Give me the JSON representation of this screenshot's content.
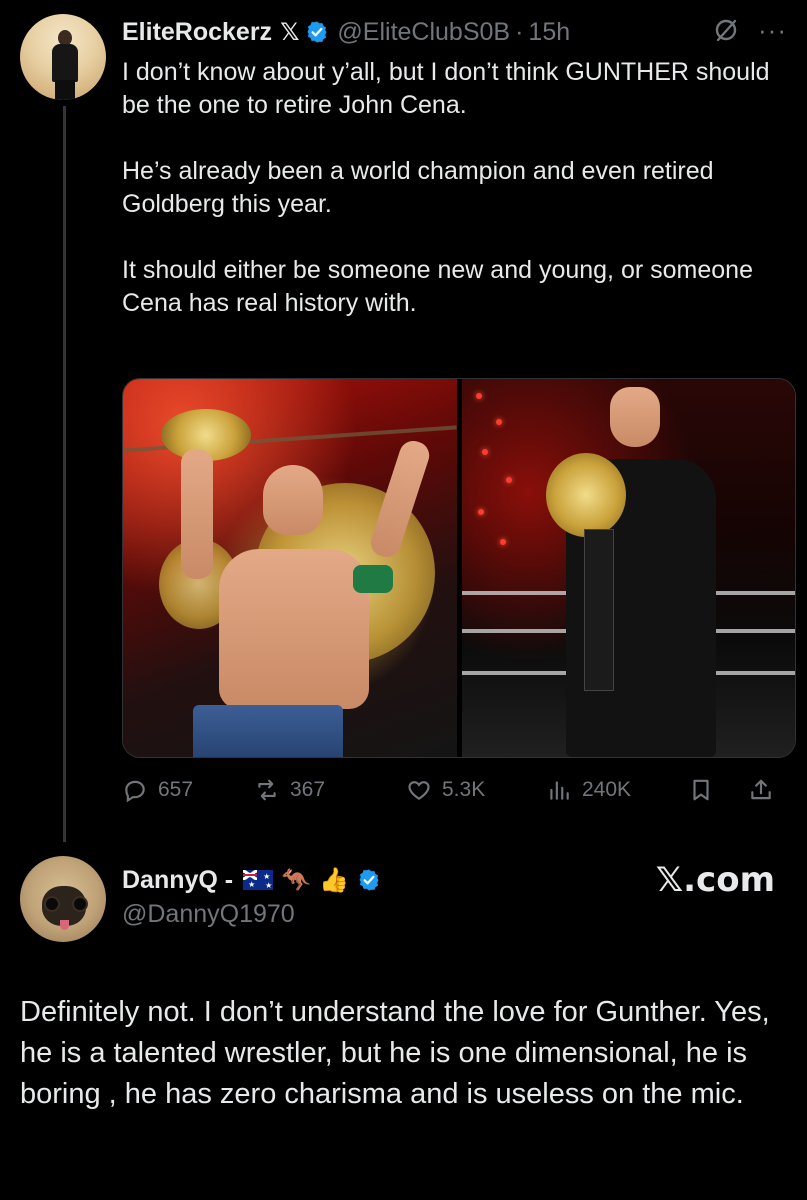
{
  "colors": {
    "background": "#000000",
    "text_primary": "#e7e9ea",
    "text_secondary": "#71767b",
    "verified_blue": "#1d9bf0"
  },
  "parent_tweet": {
    "display_name": "EliteRockerz",
    "x_badge": "𝕏",
    "handle": "@EliteClubS0B",
    "separator": "·",
    "time": "15h",
    "icons": [
      "grok-icon",
      "more-icon"
    ],
    "more_label": "···",
    "paragraphs": [
      "I don’t know about y’all, but I don’t think GUNTHER should be the one to retire John Cena.",
      "He’s already been a world champion and even retired Goldberg this year.",
      "It should either be someone new and young, or someone Cena has real history with."
    ],
    "stats": {
      "replies": "657",
      "reposts": "367",
      "likes": "5.3K",
      "views": "240K"
    }
  },
  "reply": {
    "display_name": "DannyQ -",
    "emojis": [
      "🦘",
      "👍"
    ],
    "handle": "@DannyQ1970",
    "source_label": "𝕏.com",
    "text": "Definitely not. I don’t understand the love for Gunther. Yes, he is a talented wrestler, but he is one dimensional, he is boring , he has zero charisma and is useless on the mic."
  }
}
